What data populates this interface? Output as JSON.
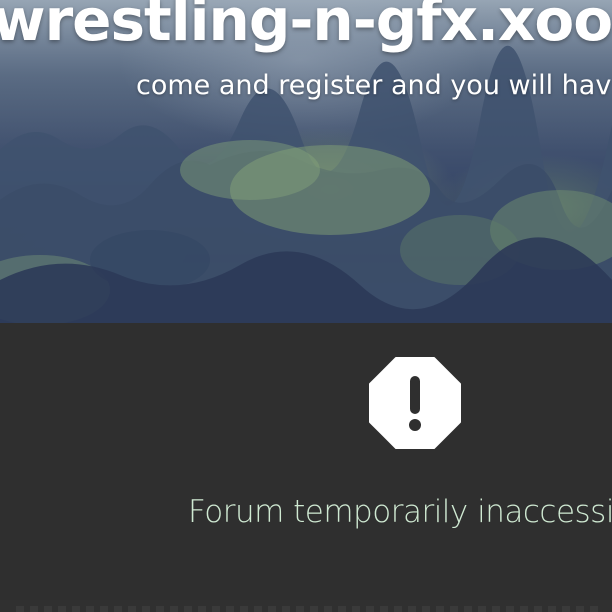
{
  "header": {
    "site_title": "wrestling-n-gfx.xoo",
    "subtitle": "come and register and you will hav"
  },
  "notice": {
    "icon": "warning-octagon-icon",
    "message": "Forum temporarily inaccessib"
  },
  "colors": {
    "panel_background": "#2f2f2f",
    "message_text": "#cfe9d2",
    "title_text": "#ffffff"
  }
}
